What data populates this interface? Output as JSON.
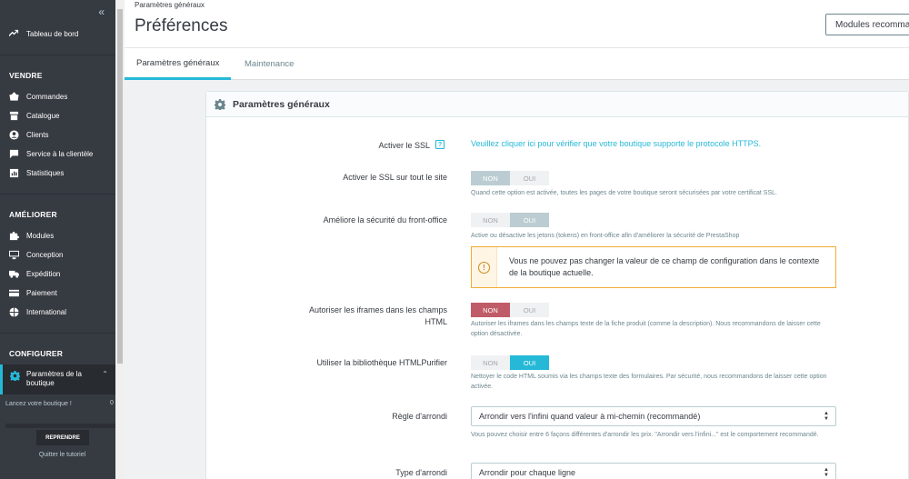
{
  "sidebar": {
    "collapse_label": "«",
    "dashboard": "Tableau de bord",
    "sections": [
      {
        "title": "VENDRE",
        "items": [
          {
            "label": "Commandes",
            "icon": "cart-icon"
          },
          {
            "label": "Catalogue",
            "icon": "store-icon"
          },
          {
            "label": "Clients",
            "icon": "user-icon"
          },
          {
            "label": "Service à la clientèle",
            "icon": "chat-icon"
          },
          {
            "label": "Statistiques",
            "icon": "chart-icon"
          }
        ]
      },
      {
        "title": "AMÉLIORER",
        "items": [
          {
            "label": "Modules",
            "icon": "puzzle-icon"
          },
          {
            "label": "Conception",
            "icon": "desktop-icon"
          },
          {
            "label": "Expédition",
            "icon": "truck-icon"
          },
          {
            "label": "Paiement",
            "icon": "credit-card-icon"
          },
          {
            "label": "International",
            "icon": "globe-icon"
          }
        ]
      },
      {
        "title": "CONFIGURER",
        "items": []
      }
    ],
    "active_item": "Paramètres de la boutique",
    "launch_text": "Lancez votre boutique !",
    "launch_percent": "0",
    "resume_button": "REPRENDRE",
    "quit_tutorial": "Quitter le tutoriel"
  },
  "header": {
    "breadcrumb": "Paramètres généraux",
    "title": "Préférences",
    "modules_button": "Modules recommandés"
  },
  "tabs": [
    {
      "label": "Paramètres généraux",
      "active": true
    },
    {
      "label": "Maintenance",
      "active": false
    }
  ],
  "panel": {
    "title": "Paramètres généraux",
    "ssl": {
      "label": "Activer le SSL",
      "info_badge": "?",
      "link": "Veuillez cliquer ici pour vérifier que votre boutique supporte le protocole HTTPS."
    },
    "ssl_all": {
      "label": "Activer le SSL sur tout le site",
      "no": "NON",
      "yes": "OUI",
      "selected": "NON",
      "help": "Quand cette option est activée, toutes les pages de votre boutique seront sécurisées par votre certificat SSL."
    },
    "front_security": {
      "label": "Améliore la sécurité du front-office",
      "no": "NON",
      "yes": "OUI",
      "selected": "OUI",
      "help": "Active ou désactive les jetons (tokens) en front-office afin d'améliorer la sécurité de PrestaShop",
      "alert_icon": "!",
      "alert": "Vous ne pouvez pas changer la valeur de ce champ de configuration dans le contexte de la boutique actuelle."
    },
    "iframes": {
      "label": "Autoriser les iframes dans les champs HTML",
      "no": "NON",
      "yes": "OUI",
      "selected": "NON",
      "help": "Autoriser les iframes dans les champs texte de la fiche produit (comme la description). Nous recommandons de laisser cette option désactivée."
    },
    "htmlpurifier": {
      "label": "Utiliser la bibliothèque HTMLPurifier",
      "no": "NON",
      "yes": "OUI",
      "selected": "OUI",
      "help": "Nettoyer le code HTML soumis via les champs texte des formulaires. Par sécurité, nous recommandons de laisser cette option activée."
    },
    "rounding_rule": {
      "label": "Règle d'arrondi",
      "value": "Arrondir vers l'infini quand valeur à mi-chemin (recommandé)",
      "help": "Vous pouvez choisir entre 6 façons différentes d'arrondir les prix. \"Arrondir vers l'infini...\" est le comportement recommandé."
    },
    "rounding_type": {
      "label": "Type d'arrondi",
      "value": "Arrondir pour chaque ligne"
    }
  },
  "colors": {
    "accent": "#25b9d7",
    "sidebar_bg": "#363a41",
    "danger": "#c05c67",
    "warning": "#f0ad36"
  }
}
